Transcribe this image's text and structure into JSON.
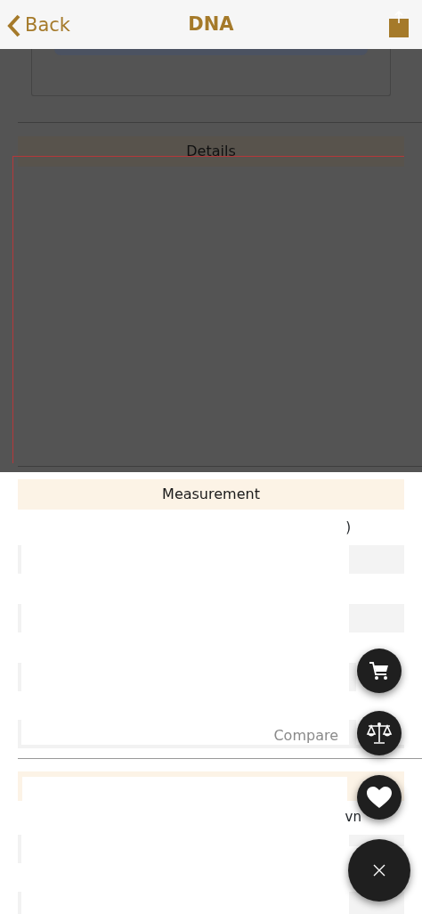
{
  "nav": {
    "back": "Back",
    "title": "DNA"
  },
  "sections": [
    {
      "title": "Details",
      "dimmed": true
    },
    {
      "title": "Measurement",
      "dimmed": false
    }
  ],
  "fragments": [
    ")",
    "Compare",
    "vn"
  ],
  "fabs": [
    {
      "kind": "cart"
    },
    {
      "kind": "compare"
    },
    {
      "kind": "favorite"
    },
    {
      "kind": "close"
    }
  ]
}
